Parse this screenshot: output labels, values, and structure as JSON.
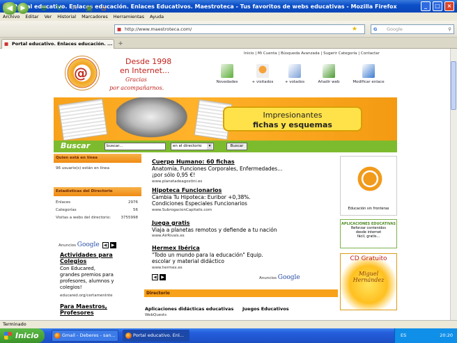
{
  "window": {
    "title": "Portal educativo. Enlaces educación. Enlaces Educativos. Maestroteca - Tus favoritos de webs educativas - Mozilla Firefox",
    "minimize": "_",
    "maximize": "□",
    "close": "×"
  },
  "menu": [
    "Archivo",
    "Editar",
    "Ver",
    "Historial",
    "Marcadores",
    "Herramientas",
    "Ayuda"
  ],
  "nav": {
    "back": "◀",
    "forward": "▶",
    "url": "http://www.maestroteca.com/",
    "search_placeholder": "Google"
  },
  "tab": {
    "label": "Portal educativo. Enlaces educación. ...",
    "new_tab": "+"
  },
  "page": {
    "top_links": "Inicio  |  Mi Cuenta  |  Búsqueda Avanzada  |  Sugerir Categoría  |  Contactar",
    "logo_text": "@",
    "slogan_line1": "Desde 1998",
    "slogan_line2": "en Internet...",
    "slogan_line3": "Gracias",
    "slogan_line4": "por acompañarnos.",
    "tools": [
      {
        "label": "Novedades"
      },
      {
        "label": "+ visitados"
      },
      {
        "label": "+ votados"
      },
      {
        "label": "Añadir web"
      },
      {
        "label": "Modificar enlace"
      }
    ],
    "banner_line1": "Impresionantes",
    "banner_line2": "fichas y esquemas",
    "search": {
      "label": "Buscar",
      "input_value": "buscar...",
      "select_value": "en el directorio",
      "button": "Buscar"
    },
    "online": {
      "header": "Quien está en línea",
      "text": "96 usuario(s) están en línea"
    },
    "stats": {
      "header": "Estadísticas del Directorio",
      "rows": [
        {
          "label": "Enlaces",
          "value": "2976"
        },
        {
          "label": "Categorías",
          "value": "56"
        },
        {
          "label": "Visitas a webs del directorio:",
          "value": "3755998"
        }
      ]
    },
    "left_ads": {
      "label": "Anuncios",
      "brand": "Google",
      "prev": "◀",
      "next": "▶",
      "ad1_title_1": "Actividades para",
      "ad1_title_2": "Colegios",
      "ad1_body_1": "Con Educared,",
      "ad1_body_2": "grandes premios para",
      "ad1_body_3": "profesores, alumnos y",
      "ad1_body_4": "colegios!",
      "ad1_url": "educared.org/certamenInte",
      "ad2_title_1": "Para Maestros,",
      "ad2_title_2": "Profesores"
    },
    "center_ads": [
      {
        "title": "Cuerpo Humano: 60 fichas",
        "body1": "Anatomía, Funciones Corporales, Enfermedades...",
        "body2": "¡por sólo 0,95 €!",
        "url": "www.planetadeagostini.es"
      },
      {
        "title": "Hipoteca Funcionarios",
        "body1": "Cambia Tu Hipoteca: Euribor +0,38%.",
        "body2": "Condiciones Especiales Funcionarios",
        "url": "www.SubrogacionCapitalis.com"
      },
      {
        "title": "Juega gratis",
        "body1": "Viaja a planetas remotos y defiende a tu nación",
        "body2": "",
        "url": "www.AirRivals.es"
      },
      {
        "title": "Hermex Ibérica",
        "body1": "\"Todo un mundo para la educación\" Equip.",
        "body2": "escolar y material didáctico",
        "url": "www.hermex.es"
      }
    ],
    "center_ads_footer": {
      "label": "Anuncios",
      "brand": "Google",
      "prev": "◀",
      "next": "▶"
    },
    "directory": {
      "header": "Directorio",
      "col1_title": "Aplicaciones didácticas educativas",
      "col1_item": "WebQuests",
      "col2_title": "Juegos Educativos"
    },
    "right_box1_caption": "Educación sin fronteras",
    "right_box2": {
      "title": "APLICACIONES EDUCATIVAS",
      "line1": "Reforzar contenidos",
      "line2": "desde internet",
      "line3": "fácil, gratis..."
    },
    "right_box3": {
      "title": "CD Gratuito",
      "name1": "Miguel",
      "name2": "Hernández"
    }
  },
  "status": "Terminado",
  "taskbar": {
    "start": "Inicio",
    "items": [
      {
        "label": "Gmail - Deberes - san..."
      },
      {
        "label": "Portal educativo. Enl..."
      }
    ],
    "lang": "ES",
    "clock": "20:20"
  },
  "colors": {
    "titlebar": "#0c4fc8",
    "accent_orange": "#f7a21a",
    "search_green": "#7dbb2e",
    "brand_red": "#c0201a"
  }
}
